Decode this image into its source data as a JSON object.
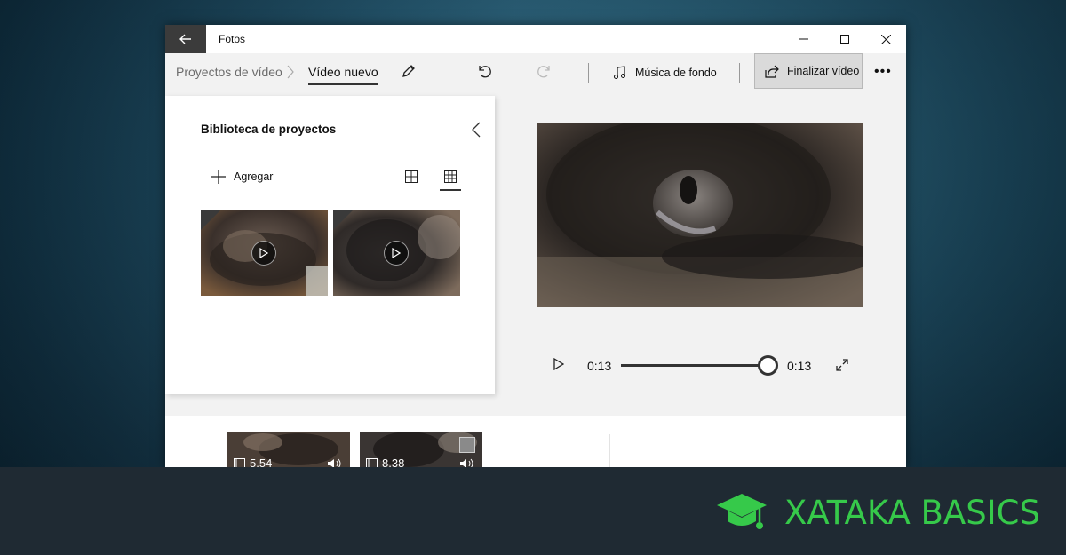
{
  "window": {
    "app_title": "Fotos"
  },
  "toolbar": {
    "breadcrumb_parent": "Proyectos de vídeo",
    "breadcrumb_current": "Vídeo nuevo",
    "music_label": "Música de fondo",
    "finalize_label": "Finalizar vídeo"
  },
  "library": {
    "title": "Biblioteca de proyectos",
    "add_label": "Agregar"
  },
  "player": {
    "current_time": "0:13",
    "total_time": "0:13",
    "progress": 1.0
  },
  "storyboard": {
    "clips": [
      {
        "duration": "5.54"
      },
      {
        "duration": "8.38"
      }
    ]
  },
  "brand": {
    "name": "XATAKA BASICS",
    "color": "#36c94a"
  },
  "icons": [
    "back-arrow-icon",
    "minimize-icon",
    "maximize-icon",
    "close-icon",
    "chevron-right-icon",
    "pencil-icon",
    "undo-icon",
    "redo-icon",
    "music-note-icon",
    "share-icon",
    "more-icon",
    "chevron-left-icon",
    "plus-icon",
    "large-grid-icon",
    "small-grid-icon",
    "play-icon",
    "fullscreen-icon",
    "clip-frame-icon",
    "speaker-icon",
    "graduation-cap-icon"
  ]
}
